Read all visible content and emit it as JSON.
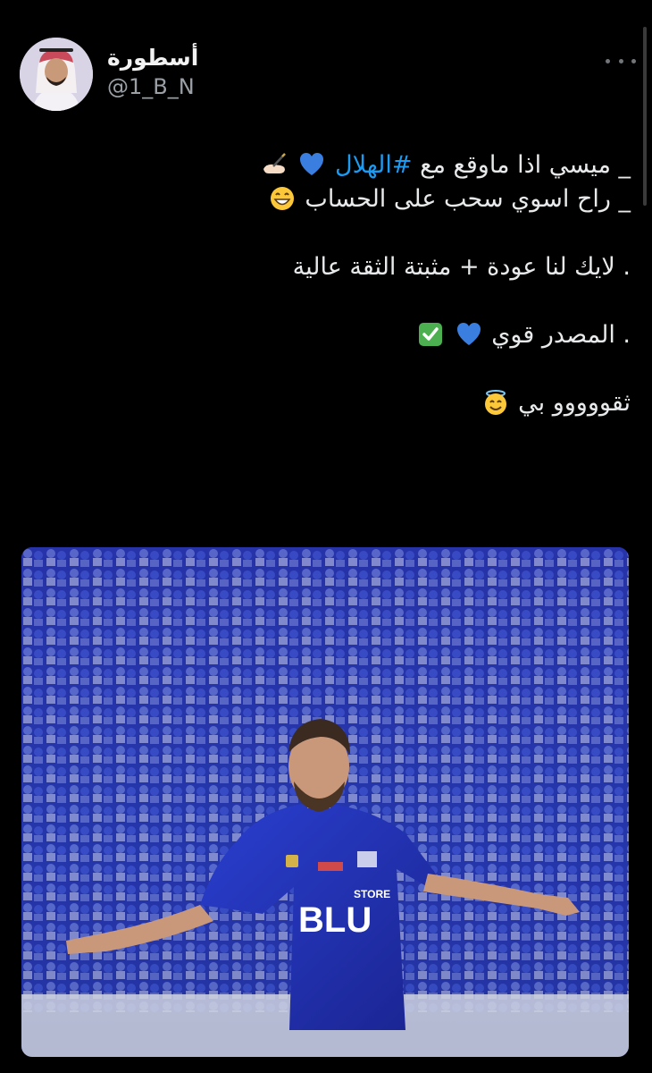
{
  "author": {
    "display_name": "أسطورة",
    "handle": "@1_B_N"
  },
  "tweet": {
    "line1_prefix": "_ ميسي اذا ماوقع مع ",
    "line1_hashtag": "#الهلال",
    "line1_emojis": [
      "blue-heart",
      "writing-hand"
    ],
    "line2_text": "_ راح اسوي سحب على الحساب",
    "line2_emojis": [
      "grinning-face"
    ],
    "line3_text": ". لايك لنا عودة + مثبتة الثقة عالية",
    "line4_text": ". المصدر قوي",
    "line4_emojis": [
      "blue-heart",
      "check-mark-button"
    ],
    "line5_text": "ثقووووو بي",
    "line5_emojis": [
      "smiling-face-with-halo"
    ]
  },
  "media": {
    "jersey_sponsor": "BLU",
    "jersey_sponsor_sub": "STORE"
  },
  "colors": {
    "background": "#000000",
    "text": "#e7e9ea",
    "hashtag": "#1d9bf0",
    "muted": "#71767b"
  }
}
